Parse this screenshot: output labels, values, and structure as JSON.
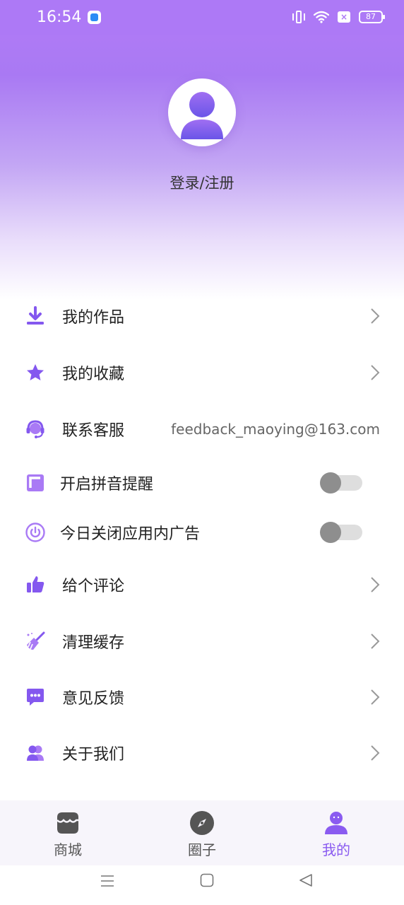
{
  "status_bar": {
    "time": "16:54",
    "battery": "87"
  },
  "profile": {
    "login_label": "登录/注册"
  },
  "menu": [
    {
      "label": "我的作品",
      "icon": "download-icon"
    },
    {
      "label": "我的收藏",
      "icon": "star-icon"
    },
    {
      "label": "联系客服",
      "icon": "headset-icon",
      "value": "feedback_maoying@163.com"
    },
    {
      "label": "开启拼音提醒",
      "icon": "pinyin-square-icon",
      "toggle_on": false
    },
    {
      "label": "今日关闭应用内广告",
      "icon": "power-icon",
      "toggle_on": false
    },
    {
      "label": "给个评论",
      "icon": "thumbs-up-icon"
    },
    {
      "label": "清理缓存",
      "icon": "broom-icon"
    },
    {
      "label": "意见反馈",
      "icon": "chat-bubble-icon"
    },
    {
      "label": "关于我们",
      "icon": "users-icon"
    }
  ],
  "bottom_nav": [
    {
      "label": "商城",
      "icon": "store-icon",
      "active": false
    },
    {
      "label": "圈子",
      "icon": "compass-icon",
      "active": false
    },
    {
      "label": "我的",
      "icon": "profile-icon",
      "active": true
    }
  ],
  "colors": {
    "accent": "#8a5bf0",
    "header_top": "#b37cf8",
    "toggle_off_knob": "#8e8e8e"
  }
}
